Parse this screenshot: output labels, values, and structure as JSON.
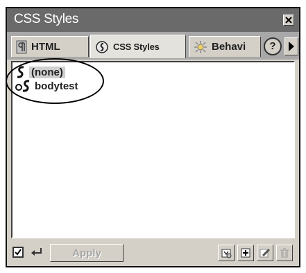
{
  "window": {
    "title": "CSS Styles"
  },
  "tabs": [
    {
      "label": "HTML",
      "icon": "paragraph-icon"
    },
    {
      "label": "CSS Styles",
      "icon": "css-styles-icon",
      "active": true
    },
    {
      "label": "Behavi",
      "icon": "behaviors-icon"
    }
  ],
  "help": {
    "label": "?"
  },
  "styles_list": [
    {
      "label": "(none)",
      "icon": "style-icon",
      "selected": true
    },
    {
      "label": "bodytest",
      "icon": "custom-style-icon"
    }
  ],
  "toolbar": {
    "apply_label": "Apply",
    "apply_checkbox_checked": true,
    "icons": [
      "attach-style-sheet-icon",
      "new-style-icon",
      "edit-style-sheet-icon",
      "delete-style-icon"
    ]
  }
}
